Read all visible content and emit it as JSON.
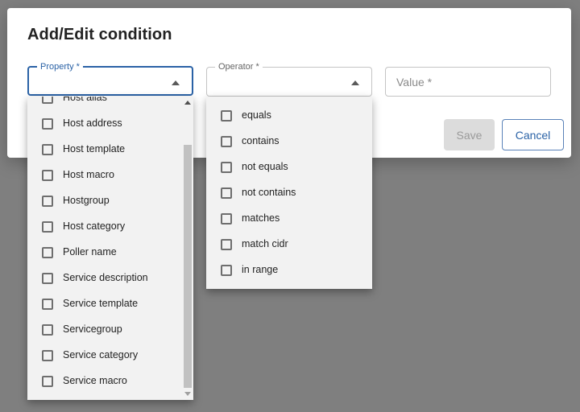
{
  "dialog": {
    "title": "Add/Edit condition",
    "property": {
      "label": "Property *",
      "value": ""
    },
    "operator": {
      "label": "Operator *",
      "value": ""
    },
    "value_field": {
      "placeholder": "Value *"
    },
    "save_label": "Save",
    "cancel_label": "Cancel"
  },
  "property_options": [
    "Host alias",
    "Host address",
    "Host template",
    "Host macro",
    "Hostgroup",
    "Host category",
    "Poller name",
    "Service description",
    "Service template",
    "Servicegroup",
    "Service category",
    "Service macro"
  ],
  "operator_options": [
    "equals",
    "contains",
    "not equals",
    "not contains",
    "matches",
    "match cidr",
    "in range"
  ]
}
